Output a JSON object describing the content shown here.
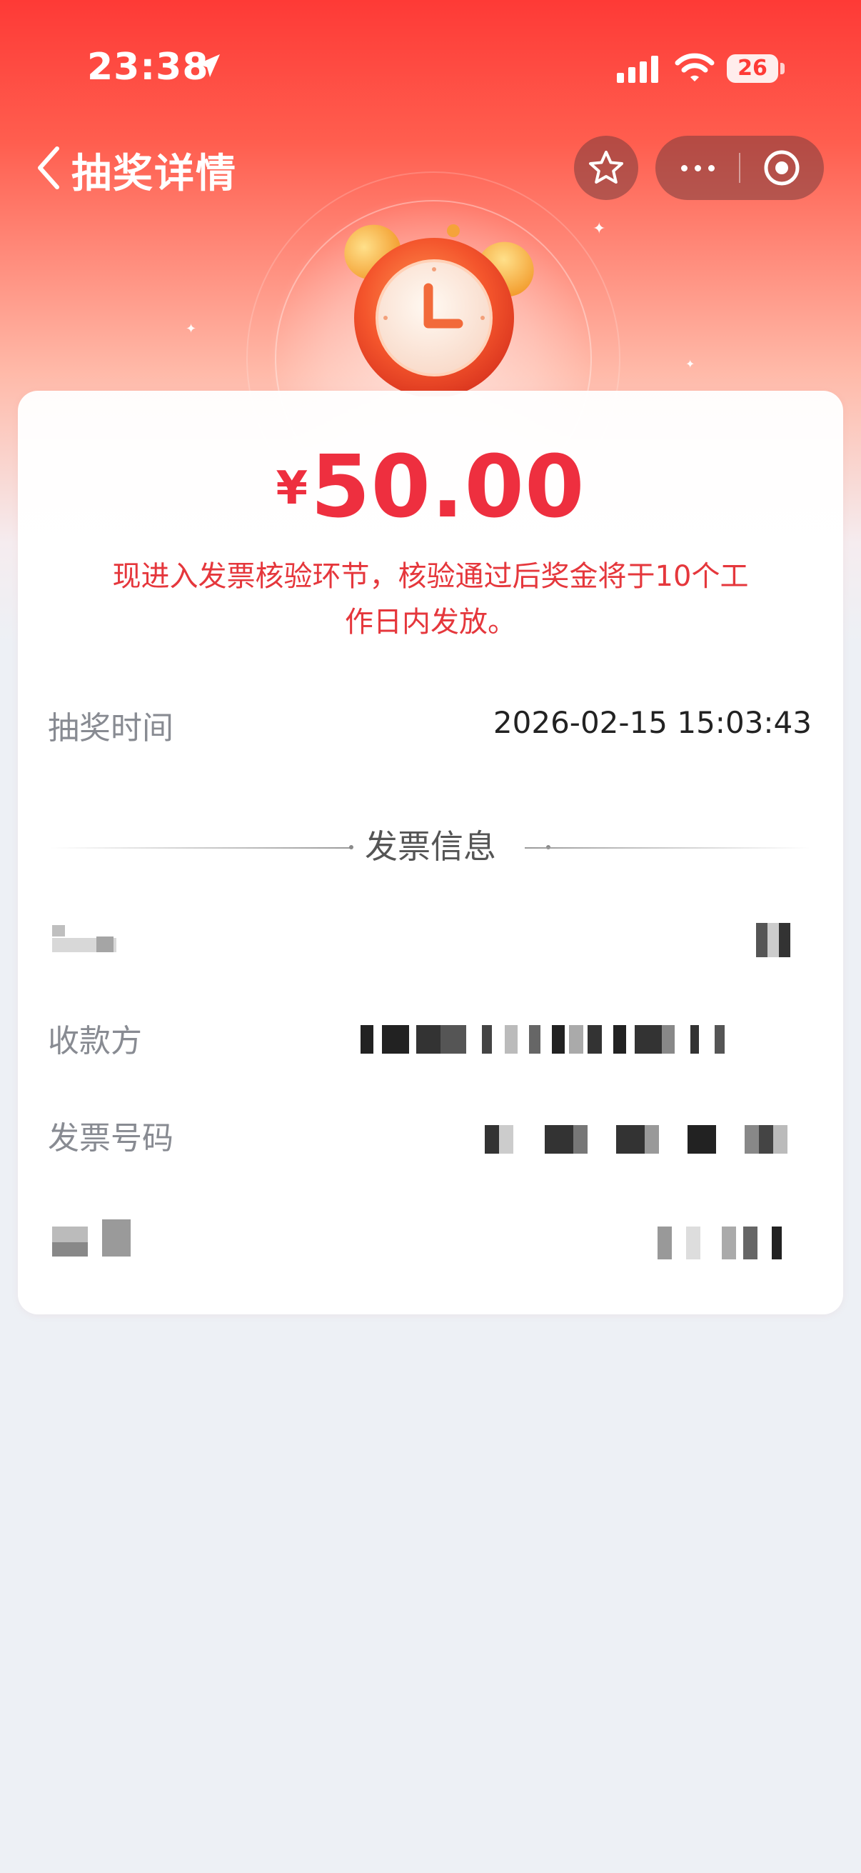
{
  "status_bar": {
    "time": "23:38",
    "battery": "26"
  },
  "nav": {
    "title": "抽奖详情"
  },
  "prize": {
    "currency": "¥",
    "amount": "50.00",
    "notice": "现进入发票核验环节，核验通过后奖金将于10个工作日内发放。"
  },
  "draw_time": {
    "label": "抽奖时间",
    "value": "2026-02-15 15:03:43"
  },
  "invoice_section": {
    "title": "发票信息",
    "rows": [
      {
        "label": "",
        "value": ""
      },
      {
        "label": "收款方",
        "value": ""
      },
      {
        "label": "发票号码",
        "value": ""
      },
      {
        "label": "",
        "value": ""
      }
    ]
  },
  "colors": {
    "brand_red": "#fe3a36",
    "amount_red": "#ee2f3f",
    "page_bg": "#edf0f5"
  },
  "icons": [
    "location-arrow-icon",
    "signal-icon",
    "wifi-icon",
    "battery-icon",
    "back-chevron-icon",
    "star-icon",
    "more-dots-icon",
    "close-target-icon",
    "alarm-clock-illustration"
  ]
}
